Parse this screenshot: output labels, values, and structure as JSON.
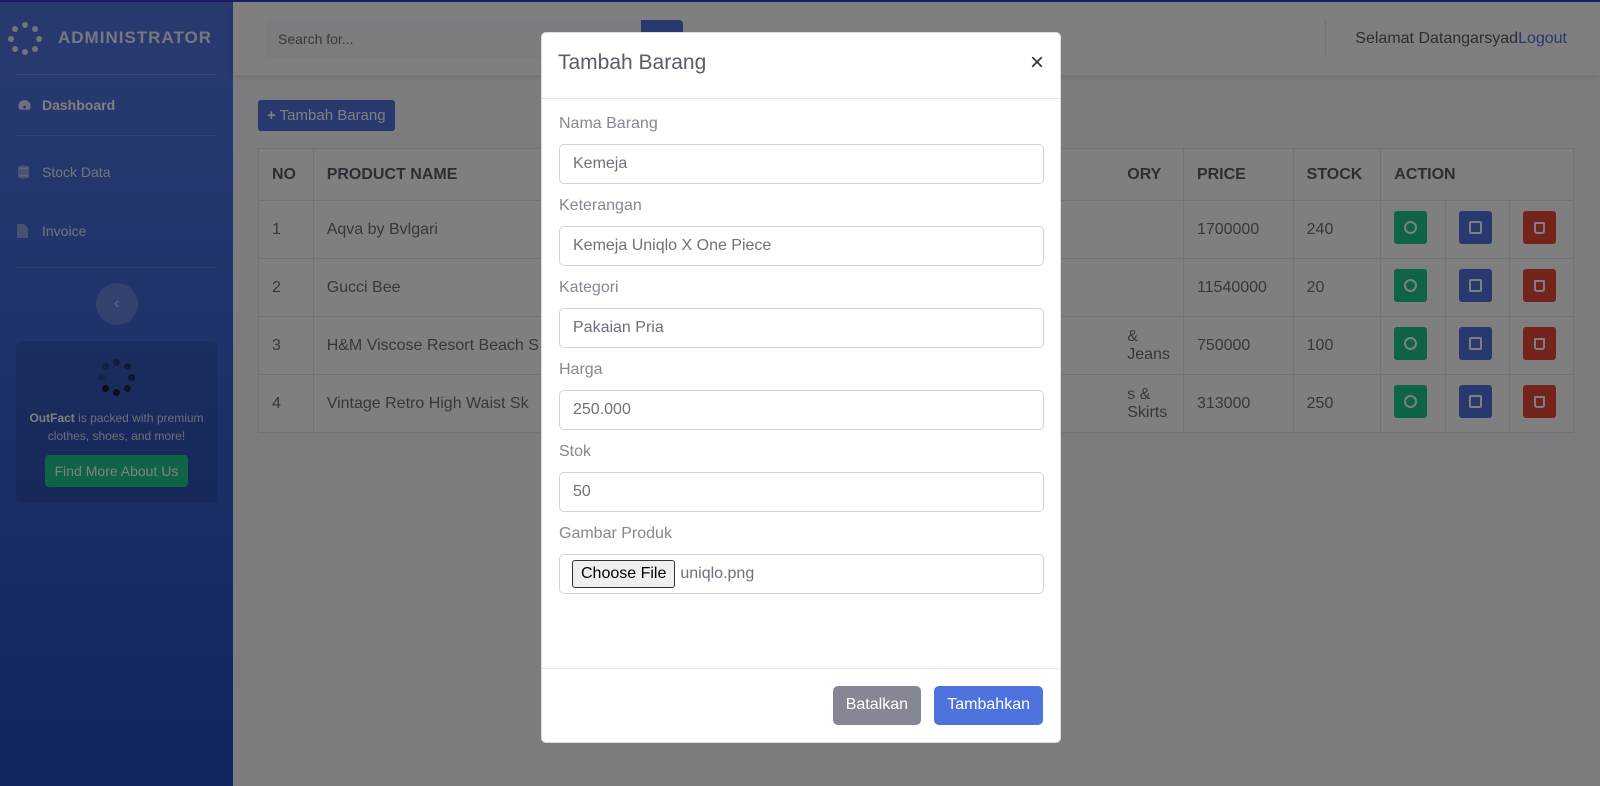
{
  "sidebar": {
    "brand": "ADMINISTRATOR",
    "items": [
      {
        "label": "Dashboard"
      },
      {
        "label": "Stock Data"
      },
      {
        "label": "Invoice"
      }
    ],
    "promo": {
      "brand_name": "OutFact",
      "text": " is packed with premium clothes, shoes, and more!",
      "button": "Find More About Us"
    }
  },
  "topbar": {
    "search_placeholder": "Search for...",
    "greeting": "Selamat Datangarsyad",
    "logout": "Logout"
  },
  "main": {
    "add_button": "Tambah Barang",
    "table": {
      "headers": [
        "NO",
        "PRODUCT NAME",
        "ORY",
        "PRICE",
        "STOCK",
        "ACTION"
      ],
      "rows": [
        {
          "no": "1",
          "name": "Aqva by Bvlgari",
          "category": "",
          "price": "1700000",
          "stock": "240"
        },
        {
          "no": "2",
          "name": "Gucci Bee",
          "category": "",
          "price": "11540000",
          "stock": "20"
        },
        {
          "no": "3",
          "name": "H&M Viscose Resort Beach S",
          "category": "& Jeans",
          "price": "750000",
          "stock": "100"
        },
        {
          "no": "4",
          "name": "Vintage Retro High Waist Sk",
          "category": "s & Skirts",
          "price": "313000",
          "stock": "250"
        }
      ]
    }
  },
  "modal": {
    "title": "Tambah Barang",
    "close": "×",
    "fields": {
      "nama": {
        "label": "Nama Barang",
        "value": "Kemeja"
      },
      "keterangan": {
        "label": "Keterangan",
        "value": "Kemeja Uniqlo X One Piece"
      },
      "kategori": {
        "label": "Kategori",
        "value": "Pakaian Pria"
      },
      "harga": {
        "label": "Harga",
        "value": "250.000"
      },
      "stok": {
        "label": "Stok",
        "value": "50"
      },
      "gambar": {
        "label": "Gambar Produk",
        "button": "Choose File",
        "filename": "uniqlo.png"
      }
    },
    "cancel": "Batalkan",
    "submit": "Tambahkan"
  },
  "colors": {
    "primary": "#4e73df",
    "success": "#1cc88a",
    "danger": "#e74a3b",
    "secondary": "#858796"
  }
}
